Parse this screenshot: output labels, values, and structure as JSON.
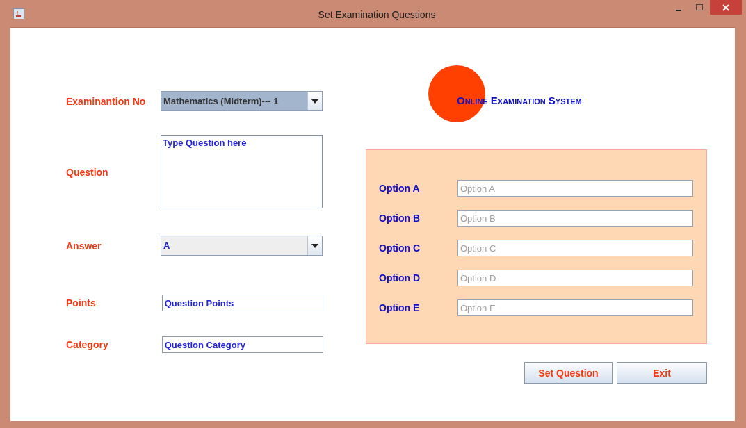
{
  "window": {
    "title": "Set Examination Questions"
  },
  "form": [
    {
      "kind": "combo",
      "label": "Examinantion No",
      "value": "Mathematics (Midterm)--- 1",
      "editable": false
    },
    {
      "kind": "area",
      "label": "Question",
      "value": "Type Question here"
    },
    {
      "kind": "combo",
      "label": "Answer",
      "value": "A",
      "editable": true
    },
    {
      "kind": "text",
      "label": "Points",
      "value": "Question Points"
    },
    {
      "kind": "text",
      "label": "Category",
      "value": "Question Category"
    }
  ],
  "logo": {
    "title": "Online Examination System"
  },
  "options": [
    {
      "label": "Option A",
      "placeholder": "Option A"
    },
    {
      "label": "Option B",
      "placeholder": "Option B"
    },
    {
      "label": "Option C",
      "placeholder": "Option C"
    },
    {
      "label": "Option D",
      "placeholder": "Option D"
    },
    {
      "label": "Option E",
      "placeholder": "Option E"
    }
  ],
  "buttons": [
    "Set Question",
    "Exit"
  ]
}
